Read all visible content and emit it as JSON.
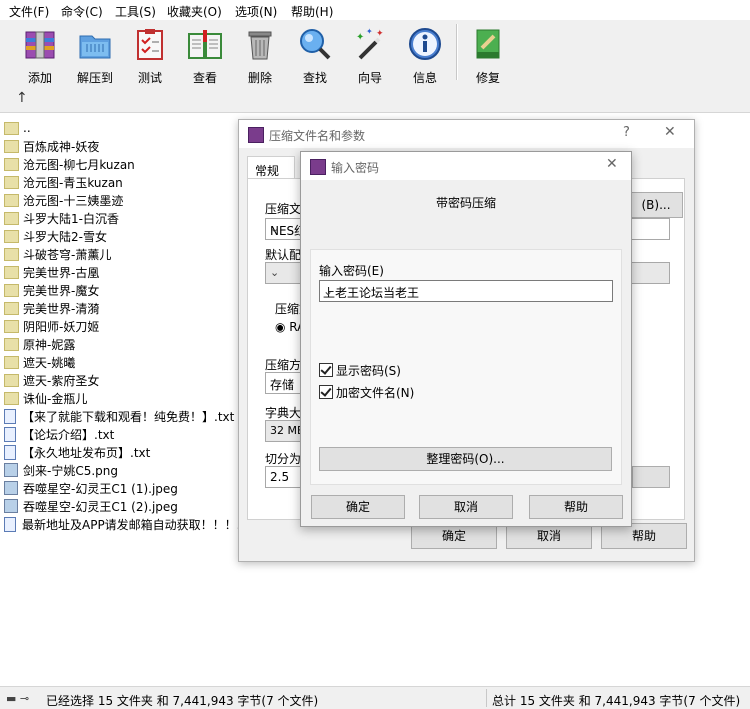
{
  "menu": [
    "文件(F)",
    "命令(C)",
    "工具(S)",
    "收藏夹(O)",
    "选项(N)",
    "帮助(H)"
  ],
  "toolbar": {
    "buttons": [
      {
        "label": "添加",
        "icon": "add-archive-icon"
      },
      {
        "label": "解压到",
        "icon": "extract-folder-icon"
      },
      {
        "label": "测试",
        "icon": "test-clipboard-icon"
      },
      {
        "label": "查看",
        "icon": "view-book-icon"
      },
      {
        "label": "删除",
        "icon": "trash-icon"
      },
      {
        "label": "查找",
        "icon": "magnifier-icon"
      },
      {
        "label": "向导",
        "icon": "wizard-wand-icon"
      },
      {
        "label": "信息",
        "icon": "info-icon"
      },
      {
        "label": "修复",
        "icon": "repair-icon"
      }
    ]
  },
  "files": [
    {
      "name": "..",
      "type": "folder"
    },
    {
      "name": "百炼成神-妖夜",
      "type": "folder"
    },
    {
      "name": "沧元图-柳七月kuzan",
      "type": "folder"
    },
    {
      "name": "沧元图-青玉kuzan",
      "type": "folder"
    },
    {
      "name": "沧元图-十三姨墨迹",
      "type": "folder"
    },
    {
      "name": "斗罗大陆1-白沉香",
      "type": "folder"
    },
    {
      "name": "斗罗大陆2-雪女",
      "type": "folder"
    },
    {
      "name": "斗破苍穹-萧薰儿",
      "type": "folder"
    },
    {
      "name": "完美世界-古凰",
      "type": "folder"
    },
    {
      "name": "完美世界-魔女",
      "type": "folder"
    },
    {
      "name": "完美世界-清漪",
      "type": "folder"
    },
    {
      "name": "阴阳师-妖刀姬",
      "type": "folder"
    },
    {
      "name": "原神-妮露",
      "type": "folder"
    },
    {
      "name": "遮天-姚曦",
      "type": "folder"
    },
    {
      "name": "遮天-紫府圣女",
      "type": "folder"
    },
    {
      "name": "诛仙-金瓶儿",
      "type": "folder"
    },
    {
      "name": "【来了就能下载和观看！纯免费！】.txt",
      "type": "txt"
    },
    {
      "name": "【论坛介绍】.txt",
      "type": "txt"
    },
    {
      "name": "【永久地址发布页】.txt",
      "type": "txt"
    },
    {
      "name": "剑来-宁姚C5.png",
      "type": "img"
    },
    {
      "name": "吞噬星空-幻灵王C1 (1).jpeg",
      "type": "img"
    },
    {
      "name": "吞噬星空-幻灵王C1 (2).jpeg",
      "type": "img"
    },
    {
      "name": "最新地址及APP请发邮箱自动获取！！！.",
      "type": "txt"
    }
  ],
  "status": {
    "left": "已经选择 15 文件夹 和 7,441,943 字节(7 个文件)",
    "right": "总计 15 文件夹 和 7,441,943 字节(7 个文件)"
  },
  "dialog1": {
    "title": "压缩文件名和参数",
    "help": "?",
    "tab": "常规",
    "archive_label": "压缩文",
    "browse_button": "(B)...",
    "archive_value": "NES红",
    "profile_label": "默认配",
    "format_label": "压缩文",
    "format_radio": "RA",
    "method_label": "压缩方",
    "method_value": "存储",
    "dict_label": "字典大",
    "dict_value": "32 MB",
    "split_label": "切分为",
    "split_value": "2.5",
    "ok": "确定",
    "cancel": "取消",
    "help_btn": "帮助"
  },
  "dialog2": {
    "title": "输入密码",
    "header": "带密码压缩",
    "password_label": "输入密码(E)",
    "password_value": "上老王论坛当老王",
    "show_password": "显示密码(S)",
    "encrypt_names": "加密文件名(N)",
    "organize": "整理密码(O)...",
    "ok": "确定",
    "cancel": "取消",
    "help": "帮助"
  }
}
